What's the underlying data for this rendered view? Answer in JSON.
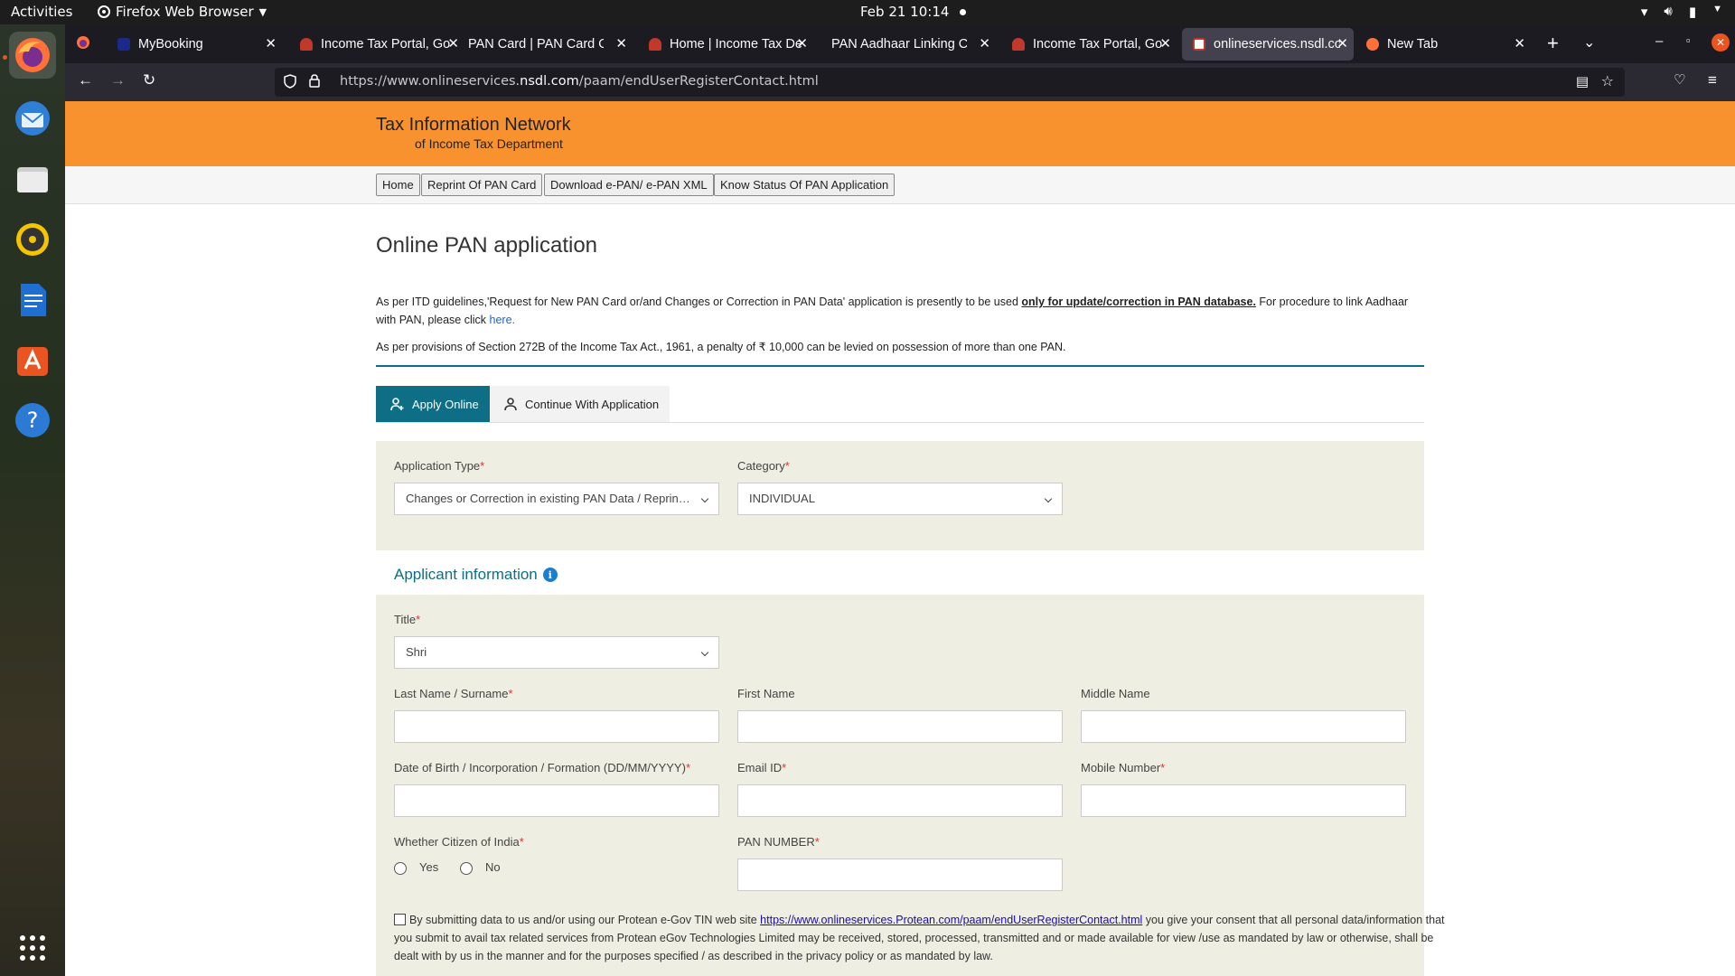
{
  "system": {
    "activities": "Activities",
    "app_menu": "Firefox Web Browser",
    "clock": "Feb 21  10:14"
  },
  "dock": [
    {
      "name": "firefox",
      "color": "#ff7139"
    },
    {
      "name": "thunderbird",
      "color": "#2f7fd6"
    },
    {
      "name": "files",
      "color": "#d9d9d9"
    },
    {
      "name": "rhythmbox",
      "color": "#f4c400"
    },
    {
      "name": "writer",
      "color": "#1e6fd1"
    },
    {
      "name": "software",
      "color": "#e95420"
    },
    {
      "name": "help",
      "color": "#2a7ad6"
    }
  ],
  "tabs": [
    {
      "title": "MyBooking"
    },
    {
      "title": "Income Tax Portal, Go"
    },
    {
      "title": "PAN Card | PAN Card On"
    },
    {
      "title": "Home | Income Tax De"
    },
    {
      "title": "PAN Aadhaar Linking Ch"
    },
    {
      "title": "Income Tax Portal, Go"
    },
    {
      "title": "onlineservices.nsdl.co"
    },
    {
      "title": "New Tab"
    }
  ],
  "url": {
    "prefix": "https://www.onlineservices.",
    "domain": "nsdl.com",
    "path": "/paam/endUserRegisterContact.html"
  },
  "header": {
    "title": "Tax Information Network",
    "subtitle": "of Income Tax Department"
  },
  "menu": [
    "Home",
    "Reprint Of PAN Card",
    "Download e-PAN/ e-PAN XML",
    "Know Status Of PAN Application"
  ],
  "page": {
    "heading": "Online PAN application",
    "note1_a": "As per ITD guidelines,'Request for New PAN Card or/and Changes or Correction in PAN Data' application is presently to be used ",
    "note1_b": "only for update/correction in PAN database.",
    "note1_c": " For procedure to link Aadhaar with PAN, please click ",
    "note1_link": "here.",
    "note2": "As per provisions of Section 272B of the Income Tax Act., 1961, a penalty of ₹ 10,000 can be levied on possession of more than one PAN."
  },
  "app_tabs": {
    "apply": "Apply Online",
    "continue": "Continue With Application"
  },
  "form": {
    "application_type_label": "Application Type",
    "application_type_value": "Changes or Correction in existing PAN Data / Reprint of PAN Card",
    "category_label": "Category",
    "category_value": "INDIVIDUAL",
    "section_title": "Applicant information",
    "title_label": "Title",
    "title_value": "Shri",
    "last_name_label": "Last Name / Surname",
    "first_name_label": "First Name",
    "middle_name_label": "Middle Name",
    "dob_label": "Date of Birth / Incorporation / Formation (DD/MM/YYYY)",
    "email_label": "Email ID",
    "mobile_label": "Mobile Number",
    "citizen_label": "Whether Citizen of India",
    "yes_label": "Yes",
    "no_label": "No",
    "pan_label": "PAN NUMBER",
    "required_mark": "*"
  },
  "consent": {
    "text_a": "By submitting data to us and/or using our Protean e-Gov TIN web site ",
    "link": "https://www.onlineservices.Protean.com/paam/endUserRegisterContact.html",
    "text_b": " you give your consent that all personal data/information that you submit to avail tax related services from Protean eGov Technologies Limited may be received, stored, processed, transmitted and or made available for view /use as mandated by law or otherwise, shall be dealt with by us in the manner and for the purposes specified / as described in the privacy policy or as mandated by law."
  }
}
